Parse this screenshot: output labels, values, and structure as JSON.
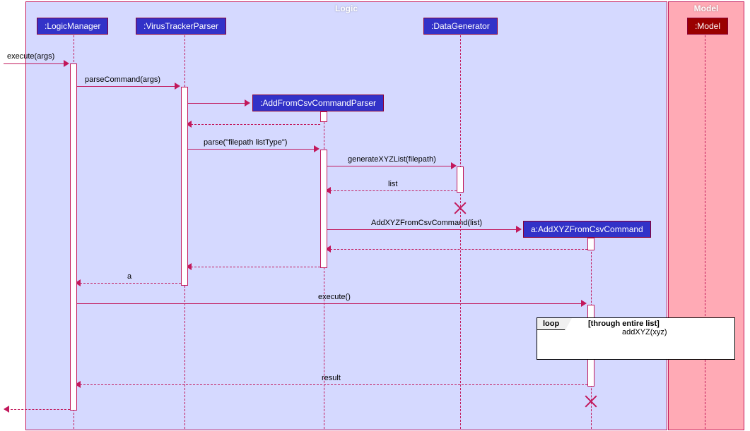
{
  "frames": {
    "logic": {
      "title": "Logic"
    },
    "model": {
      "title": "Model"
    }
  },
  "participants": {
    "logicManager": ":LogicManager",
    "virusTrackerParser": ":VirusTrackerParser",
    "addFromCsvCommandParser": ":AddFromCsvCommandParser",
    "dataGenerator": ":DataGenerator",
    "addXYZFromCsvCommand": "a:AddXYZFromCsvCommand",
    "model": ":Model"
  },
  "messages": {
    "executeArgs": "execute(args)",
    "parseCommand": "parseCommand(args)",
    "parseFilepath": "parse(\"filepath listType\")",
    "generateXYZList": "generateXYZList(filepath)",
    "listReturn": "list",
    "addXYZFromCsvCommand": "AddXYZFromCsvCommand(list)",
    "aReturn": "a",
    "execute": "execute()",
    "addXYZ": "addXYZ(xyz)",
    "result": "result"
  },
  "loop": {
    "label": "loop",
    "condition": "[through entire list]"
  },
  "chart_data": {
    "type": "sequence_diagram",
    "frames": [
      {
        "name": "Logic",
        "participants": [
          ":LogicManager",
          ":VirusTrackerParser",
          ":AddFromCsvCommandParser",
          ":DataGenerator",
          "a:AddXYZFromCsvCommand"
        ]
      },
      {
        "name": "Model",
        "participants": [
          ":Model"
        ]
      }
    ],
    "messages": [
      {
        "from": "external",
        "to": ":LogicManager",
        "label": "execute(args)",
        "type": "sync"
      },
      {
        "from": ":LogicManager",
        "to": ":VirusTrackerParser",
        "label": "parseCommand(args)",
        "type": "sync"
      },
      {
        "from": ":VirusTrackerParser",
        "to": ":AddFromCsvCommandParser",
        "label": "",
        "type": "create"
      },
      {
        "from": ":AddFromCsvCommandParser",
        "to": ":VirusTrackerParser",
        "label": "",
        "type": "return"
      },
      {
        "from": ":VirusTrackerParser",
        "to": ":AddFromCsvCommandParser",
        "label": "parse(\"filepath listType\")",
        "type": "sync"
      },
      {
        "from": ":AddFromCsvCommandParser",
        "to": ":DataGenerator",
        "label": "generateXYZList(filepath)",
        "type": "sync"
      },
      {
        "from": ":DataGenerator",
        "to": ":AddFromCsvCommandParser",
        "label": "list",
        "type": "return"
      },
      {
        "note": ":DataGenerator destroyed"
      },
      {
        "from": ":AddFromCsvCommandParser",
        "to": "a:AddXYZFromCsvCommand",
        "label": "AddXYZFromCsvCommand(list)",
        "type": "create"
      },
      {
        "from": "a:AddXYZFromCsvCommand",
        "to": ":AddFromCsvCommandParser",
        "label": "",
        "type": "return"
      },
      {
        "from": ":AddFromCsvCommandParser",
        "to": ":VirusTrackerParser",
        "label": "",
        "type": "return"
      },
      {
        "from": ":VirusTrackerParser",
        "to": ":LogicManager",
        "label": "a",
        "type": "return"
      },
      {
        "from": ":LogicManager",
        "to": "a:AddXYZFromCsvCommand",
        "label": "execute()",
        "type": "sync"
      },
      {
        "fragment": "loop",
        "condition": "through entire list",
        "messages": [
          {
            "from": "a:AddXYZFromCsvCommand",
            "to": ":Model",
            "label": "addXYZ(xyz)",
            "type": "sync"
          },
          {
            "from": ":Model",
            "to": "a:AddXYZFromCsvCommand",
            "label": "",
            "type": "return"
          }
        ]
      },
      {
        "note": "a:AddXYZFromCsvCommand destroyed"
      },
      {
        "from": "a:AddXYZFromCsvCommand",
        "to": ":LogicManager",
        "label": "result",
        "type": "return"
      },
      {
        "from": ":LogicManager",
        "to": "external",
        "label": "",
        "type": "return"
      }
    ]
  }
}
